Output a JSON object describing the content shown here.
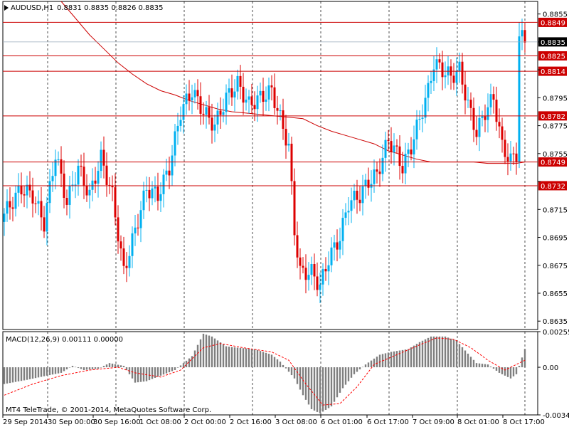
{
  "header": {
    "symbol_tf": "AUDUSD,H1",
    "ohlc": "0.8831 0.8835 0.8826 0.8835"
  },
  "copyright": "MT4 TeleTrade, © 2001-2014, MetaQuotes Software Corp.",
  "colors": {
    "bull": "#00b0f0",
    "bear": "#dd0000",
    "ma": "#cc0000",
    "hline": "#cc0000",
    "grid": "#000000",
    "hist": "#7f7f7f",
    "signal": "#ff0000",
    "current": "#000000"
  },
  "chart_data": [
    {
      "type": "candlestick",
      "title": "AUDUSD,H1",
      "y_range": [
        0.8629,
        0.8864
      ],
      "y_ticks": [
        "0.8855",
        "0.8835",
        "0.8815",
        "0.8795",
        "0.8775",
        "0.8755",
        "0.8735",
        "0.8715",
        "0.8695",
        "0.8675",
        "0.8655",
        "0.8635"
      ],
      "x_ticks": [
        "29 Sep 2014",
        "30 Sep 00:00",
        "30 Sep 16:00",
        "1 Oct 08:00",
        "2 Oct 00:00",
        "2 Oct 16:00",
        "3 Oct 08:00",
        "6 Oct 01:00",
        "6 Oct 17:00",
        "7 Oct 09:00",
        "8 Oct 01:00",
        "8 Oct 17:00"
      ],
      "grid": true,
      "current_price": "0.8835",
      "levels": [
        {
          "label": "0.8849",
          "value": 0.8849
        },
        {
          "label": "0.8825",
          "value": 0.8825
        },
        {
          "label": "0.8814",
          "value": 0.8814
        },
        {
          "label": "0.8782",
          "value": 0.8782
        },
        {
          "label": "0.8749",
          "value": 0.8749
        },
        {
          "label": "0.8732",
          "value": 0.8732
        }
      ],
      "close_anchors": [
        [
          0,
          0.8712
        ],
        [
          6,
          0.873
        ],
        [
          10,
          0.8725
        ],
        [
          14,
          0.8705
        ],
        [
          18,
          0.8755
        ],
        [
          22,
          0.872
        ],
        [
          26,
          0.8745
        ],
        [
          30,
          0.8725
        ],
        [
          34,
          0.8752
        ],
        [
          38,
          0.8725
        ],
        [
          42,
          0.867
        ],
        [
          46,
          0.87
        ],
        [
          50,
          0.873
        ],
        [
          54,
          0.8725
        ],
        [
          58,
          0.8745
        ],
        [
          62,
          0.8785
        ],
        [
          66,
          0.88
        ],
        [
          70,
          0.8785
        ],
        [
          74,
          0.8775
        ],
        [
          78,
          0.8795
        ],
        [
          82,
          0.8805
        ],
        [
          86,
          0.879
        ],
        [
          90,
          0.8795
        ],
        [
          94,
          0.88
        ],
        [
          97,
          0.878
        ],
        [
          100,
          0.876
        ],
        [
          102,
          0.87
        ],
        [
          104,
          0.867
        ],
        [
          108,
          0.867
        ],
        [
          111,
          0.866
        ],
        [
          114,
          0.868
        ],
        [
          118,
          0.8695
        ],
        [
          121,
          0.872
        ],
        [
          125,
          0.8725
        ],
        [
          128,
          0.8735
        ],
        [
          131,
          0.874
        ],
        [
          135,
          0.8765
        ],
        [
          138,
          0.8755
        ],
        [
          140,
          0.8745
        ],
        [
          143,
          0.876
        ],
        [
          146,
          0.878
        ],
        [
          149,
          0.88
        ],
        [
          151,
          0.882
        ],
        [
          154,
          0.8815
        ],
        [
          157,
          0.881
        ],
        [
          160,
          0.8815
        ],
        [
          163,
          0.879
        ],
        [
          166,
          0.877
        ],
        [
          169,
          0.8785
        ],
        [
          172,
          0.8795
        ],
        [
          175,
          0.876
        ],
        [
          178,
          0.875
        ],
        [
          180,
          0.8755
        ],
        [
          181,
          0.884
        ],
        [
          183,
          0.8835
        ]
      ],
      "ma_name": "",
      "ma": [
        [
          20,
          0.8864
        ],
        [
          25,
          0.8852
        ],
        [
          30,
          0.884
        ],
        [
          35,
          0.883
        ],
        [
          40,
          0.882
        ],
        [
          45,
          0.8812
        ],
        [
          50,
          0.8805
        ],
        [
          55,
          0.88
        ],
        [
          60,
          0.8797
        ],
        [
          65,
          0.8793
        ],
        [
          70,
          0.879
        ],
        [
          75,
          0.8787
        ],
        [
          80,
          0.8785
        ],
        [
          85,
          0.8784
        ],
        [
          90,
          0.8783
        ],
        [
          95,
          0.8782
        ],
        [
          100,
          0.8781
        ],
        [
          105,
          0.878
        ],
        [
          110,
          0.8775
        ],
        [
          115,
          0.8771
        ],
        [
          120,
          0.8768
        ],
        [
          125,
          0.8765
        ],
        [
          130,
          0.8762
        ],
        [
          135,
          0.8757
        ],
        [
          140,
          0.8754
        ],
        [
          145,
          0.8751
        ],
        [
          150,
          0.8749
        ],
        [
          155,
          0.8749
        ],
        [
          160,
          0.8749
        ],
        [
          165,
          0.8749
        ],
        [
          170,
          0.8748
        ],
        [
          175,
          0.8748
        ],
        [
          180,
          0.8748
        ],
        [
          183,
          0.8749
        ]
      ]
    },
    {
      "type": "histogram",
      "title": "MACD(12,26,9) 0.00111 0.00000",
      "y_range": [
        -0.00341,
        0.00255
      ],
      "y_ticks": [
        "0.00255",
        "0.00",
        "-0.00341"
      ],
      "macd_anchors": [
        [
          0,
          -0.0012
        ],
        [
          8,
          -0.0009
        ],
        [
          15,
          -0.0006
        ],
        [
          20,
          -0.0004
        ],
        [
          24,
          0.0001
        ],
        [
          28,
          -0.0002
        ],
        [
          33,
          -0.0001
        ],
        [
          37,
          0.0003
        ],
        [
          42,
          0.0001
        ],
        [
          46,
          -0.0011
        ],
        [
          50,
          -0.001
        ],
        [
          55,
          -0.0006
        ],
        [
          60,
          -0.0002
        ],
        [
          66,
          0.0008
        ],
        [
          70,
          0.0024
        ],
        [
          73,
          0.0022
        ],
        [
          78,
          0.0015
        ],
        [
          82,
          0.0014
        ],
        [
          88,
          0.0013
        ],
        [
          94,
          0.0009
        ],
        [
          97,
          0.0004
        ],
        [
          102,
          -0.0008
        ],
        [
          105,
          -0.002
        ],
        [
          108,
          -0.003
        ],
        [
          111,
          -0.0033
        ],
        [
          115,
          -0.0028
        ],
        [
          119,
          -0.0015
        ],
        [
          123,
          -0.0005
        ],
        [
          127,
          0.0002
        ],
        [
          132,
          0.0009
        ],
        [
          136,
          0.0011
        ],
        [
          142,
          0.0013
        ],
        [
          146,
          0.0018
        ],
        [
          150,
          0.0022
        ],
        [
          155,
          0.0022
        ],
        [
          159,
          0.0019
        ],
        [
          162,
          0.0012
        ],
        [
          166,
          0.0003
        ],
        [
          170,
          0.0002
        ],
        [
          174,
          -0.0004
        ],
        [
          178,
          -0.0008
        ],
        [
          180,
          -0.0005
        ],
        [
          182,
          0.0007
        ],
        [
          183,
          0.0013
        ]
      ],
      "signal_anchors": [
        [
          0,
          -0.002
        ],
        [
          10,
          -0.0012
        ],
        [
          20,
          -0.0006
        ],
        [
          30,
          -0.0002
        ],
        [
          40,
          0.0
        ],
        [
          46,
          -0.0004
        ],
        [
          55,
          -0.0007
        ],
        [
          62,
          -0.0002
        ],
        [
          70,
          0.0014
        ],
        [
          76,
          0.0017
        ],
        [
          84,
          0.0014
        ],
        [
          94,
          0.0011
        ],
        [
          100,
          0.0005
        ],
        [
          106,
          -0.0012
        ],
        [
          112,
          -0.0027
        ],
        [
          118,
          -0.0026
        ],
        [
          124,
          -0.0014
        ],
        [
          130,
          0.0002
        ],
        [
          138,
          0.0009
        ],
        [
          146,
          0.0016
        ],
        [
          152,
          0.0021
        ],
        [
          158,
          0.002
        ],
        [
          164,
          0.0014
        ],
        [
          170,
          0.0005
        ],
        [
          176,
          -0.0002
        ],
        [
          183,
          0.0005
        ]
      ]
    }
  ]
}
